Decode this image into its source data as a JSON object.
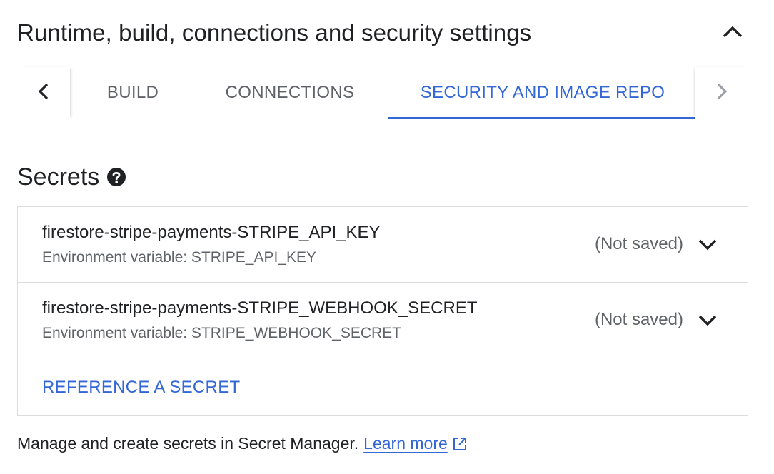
{
  "section": {
    "title": "Runtime, build, connections and security settings",
    "collapse_icon": "chevron-up-icon"
  },
  "tabs": {
    "prev_icon": "chevron-left-icon",
    "next_icon": "chevron-right-icon",
    "items": [
      {
        "label": "BUILD",
        "active": false
      },
      {
        "label": "CONNECTIONS",
        "active": false
      },
      {
        "label": "SECURITY AND IMAGE REPO",
        "active": true
      }
    ]
  },
  "secrets": {
    "title": "Secrets",
    "help_icon": "help-circle-icon",
    "items": [
      {
        "name": "firestore-stripe-payments-STRIPE_API_KEY",
        "env": "Environment variable: STRIPE_API_KEY",
        "status": "(Not saved)",
        "expand_icon": "chevron-down-icon"
      },
      {
        "name": "firestore-stripe-payments-STRIPE_WEBHOOK_SECRET",
        "env": "Environment variable: STRIPE_WEBHOOK_SECRET",
        "status": "(Not saved)",
        "expand_icon": "chevron-down-icon"
      }
    ],
    "reference_label": "REFERENCE A SECRET"
  },
  "footer": {
    "text": "Manage and create secrets in Secret Manager.",
    "link_label": "Learn more",
    "link_icon": "external-link-icon"
  },
  "colors": {
    "accent": "#3367d6",
    "text_primary": "#202124",
    "text_secondary": "#5f6368",
    "border": "#dadce0"
  }
}
